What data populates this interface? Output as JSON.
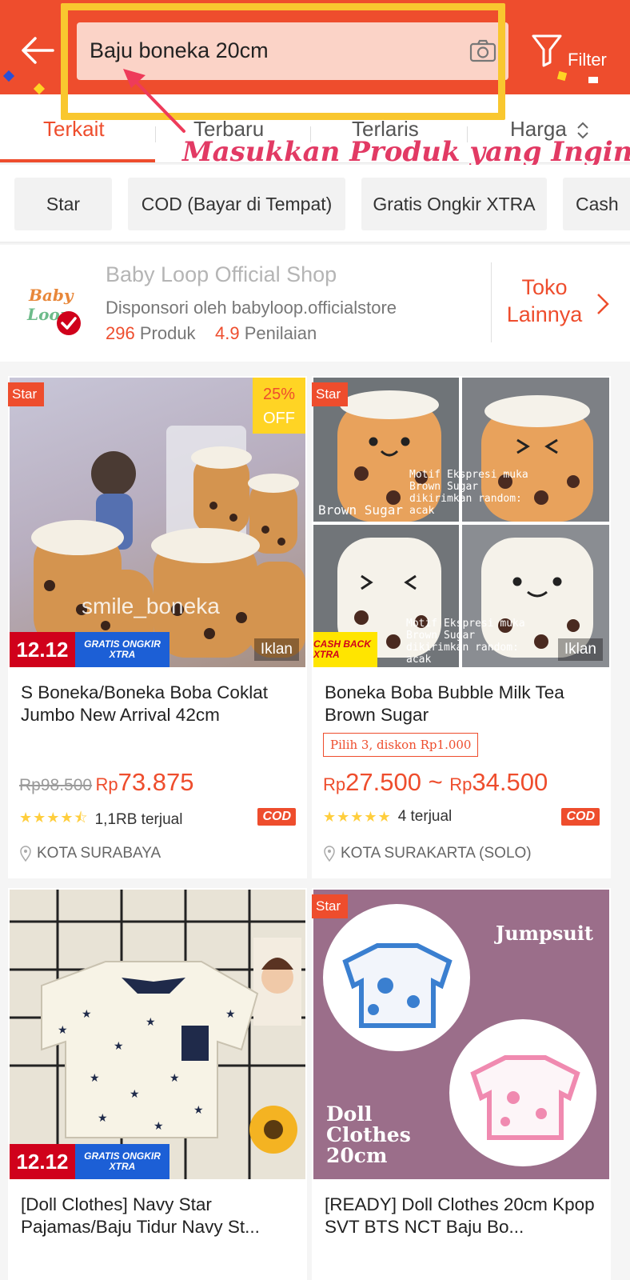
{
  "header": {
    "search_value": "Baju boneka 20cm",
    "filter_label": "Filter"
  },
  "tabs": [
    "Terkait",
    "Terbaru",
    "Terlaris",
    "Harga"
  ],
  "annotation": "Masukkan Produk yang Ingin Dicari",
  "chips": [
    "Star",
    "COD (Bayar di Tempat)",
    "Gratis Ongkir XTRA",
    "Cash"
  ],
  "shop": {
    "name": "Baby Loop Official Shop",
    "sponsored": "Disponsori oleh babyloop.officialstore",
    "products_count": "296",
    "products_label": "Produk",
    "rating": "4.9",
    "rating_label": "Penilaian",
    "more_label": "Toko Lainnya"
  },
  "products": [
    {
      "badge": "Star",
      "discount": "25%",
      "discount_suffix": "OFF",
      "ad": "Iklan",
      "promo_a": "12.12",
      "promo_b": "GRATIS ONGKIR XTRA",
      "image_caption": "smile_boneka",
      "title": " S Boneka/Boneka Boba Coklat Jumbo New Arrival 42cm",
      "price_old": "Rp98.500",
      "price_cur": "Rp",
      "price": "73.875",
      "sold": "1,1RB terjual",
      "cod": "COD",
      "location": "KOTA SURABAYA",
      "rating_stars": 4.5
    },
    {
      "badge": "Star",
      "ad": "Iklan",
      "cashback": "CASH BACK XTRA",
      "image_caption_1": "Brown Sugar",
      "image_caption_2": "Motif Ekspresi muka Brown Sugar dikirimkan random: acak",
      "title": " Boneka Boba Bubble Milk Tea Brown Sugar",
      "voucher": "Pilih 3, diskon Rp1.000",
      "price_cur_1": "Rp",
      "price_1": "27.500",
      "price_sep": " ~ ",
      "price_cur_2": "Rp",
      "price_2": "34.500",
      "sold": "4 terjual",
      "cod": "COD",
      "location": "KOTA SURAKARTA (SOLO)",
      "rating_stars": 5
    },
    {
      "promo_a": "12.12",
      "promo_b": "GRATIS ONGKIR XTRA",
      "title": " [Doll Clothes] Navy Star Pajamas/Baju Tidur Navy St..."
    },
    {
      "badge": "Star",
      "image_caption_1": "Jumpsuit",
      "image_caption_2": "Doll Clothes 20cm",
      "title": " [READY] Doll Clothes 20cm Kpop SVT BTS NCT Baju Bo..."
    }
  ],
  "colors": {
    "brand": "#ee4d2d",
    "highlight": "#f9c72f",
    "annotation": "#e23a64"
  }
}
